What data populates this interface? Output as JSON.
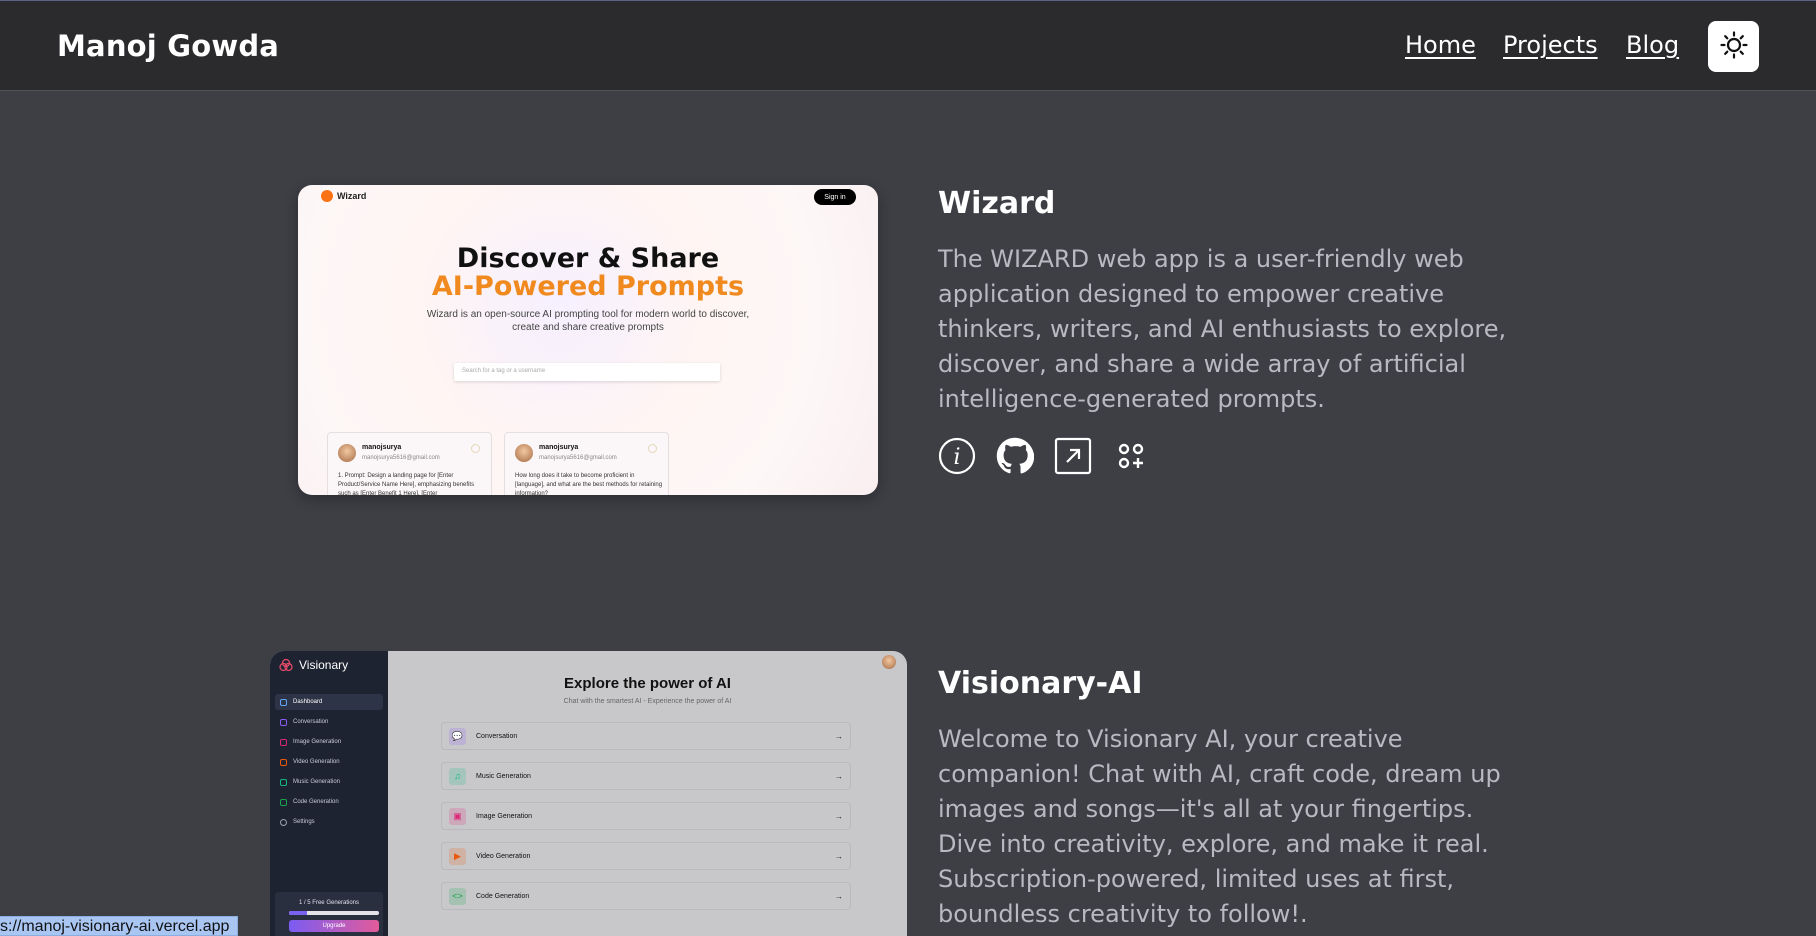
{
  "header": {
    "brand": "Manoj Gowda",
    "nav": [
      {
        "label": "Home"
      },
      {
        "label": "Projects"
      },
      {
        "label": "Blog"
      }
    ],
    "theme_toggle_icon": "sun-icon"
  },
  "projects": [
    {
      "title": "Wizard",
      "description": "The WIZARD web app is a user-friendly web application designed to empower creative thinkers, writers, and AI enthusiasts to explore, discover, and share a wide array of artificial intelligence-generated prompts.",
      "icons": [
        "info-icon",
        "github-icon",
        "external-link-icon",
        "tech-stack-icon"
      ],
      "screenshot": {
        "logo": "Wizard",
        "signin": "Sign in",
        "headline1": "Discover & Share",
        "headline2": "AI-Powered Prompts",
        "subtitle": "Wizard is an open-source AI prompting tool for modern world to discover, create and share creative prompts",
        "search_placeholder": "Search for a tag or a username",
        "cards": [
          {
            "name": "manojsurya",
            "email": "manojsurya5616@gmail.com",
            "text": "1. Prompt: Design a landing page for [Enter Product/Service Name Here], emphasizing benefits such as [Enter Benefit 1 Here], [Enter"
          },
          {
            "name": "manojsurya",
            "email": "manojsurya5616@gmail.com",
            "text": "How long does it take to become proficient in [language], and what are the best methods for retaining information?"
          }
        ]
      }
    },
    {
      "title": "Visionary-AI",
      "description": "Welcome to Visionary AI, your creative companion! Chat with AI, craft code, dream up images and songs—it's all at your fingertips. Dive into creativity, explore, and make it real. Subscription-powered, limited uses at first, boundless creativity to follow!.",
      "screenshot": {
        "logo": "Visionary",
        "sidebar": [
          "Dashboard",
          "Conversation",
          "Image Generation",
          "Video Generation",
          "Music Generation",
          "Code Generation",
          "Settings"
        ],
        "free_generations": "1 / 5 Free Generations",
        "free_generations_progress": 0.2,
        "upgrade": "Upgrade",
        "title": "Explore the power of AI",
        "subtitle": "Chat with the smartest AI - Experience the power of AI",
        "tools": [
          {
            "label": "Conversation",
            "color": "#8b5cf6",
            "glyph": "💬"
          },
          {
            "label": "Music Generation",
            "color": "#10b981",
            "glyph": "♫"
          },
          {
            "label": "Image Generation",
            "color": "#db2777",
            "glyph": "▣"
          },
          {
            "label": "Video Generation",
            "color": "#ea580c",
            "glyph": "▶"
          },
          {
            "label": "Code Generation",
            "color": "#16a34a",
            "glyph": "<>"
          }
        ],
        "arrow": "→"
      }
    }
  ],
  "status_url": "s://manoj-visionary-ai.vercel.app"
}
